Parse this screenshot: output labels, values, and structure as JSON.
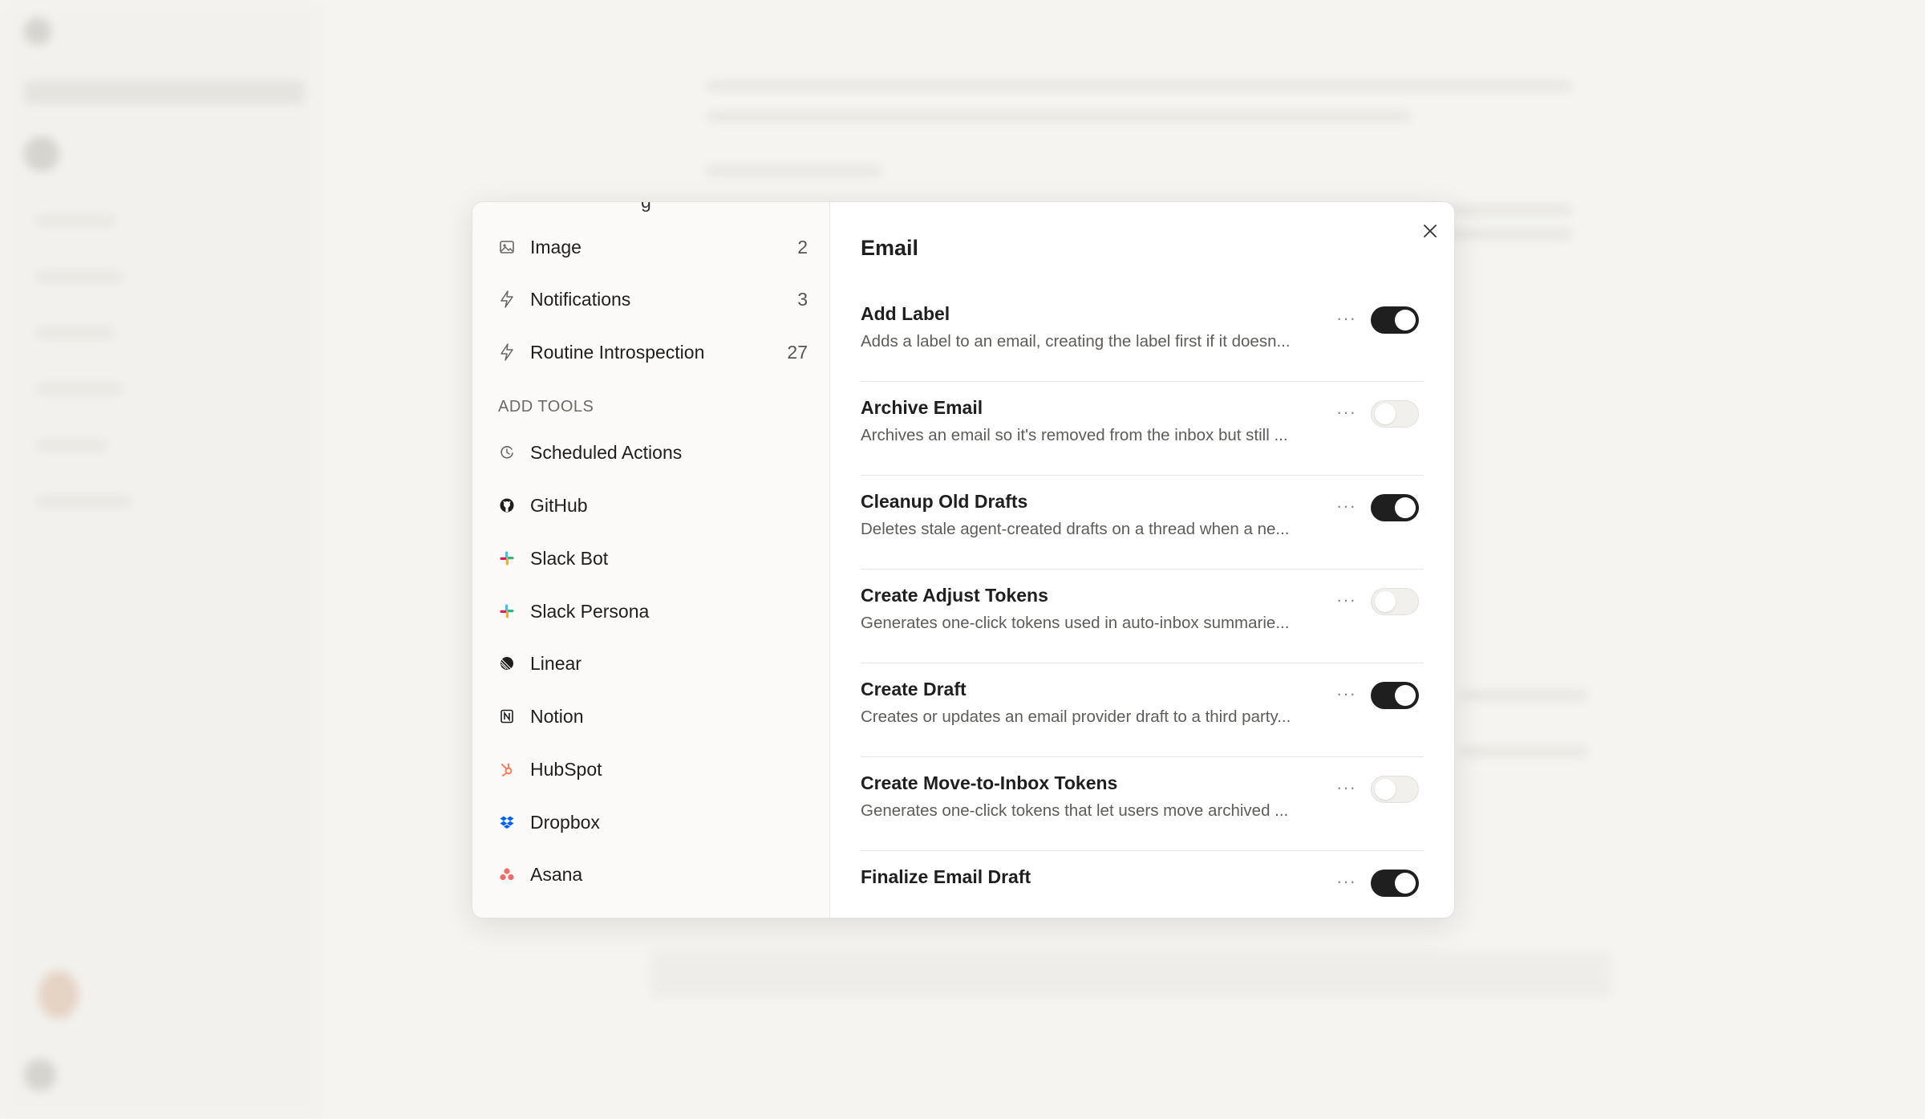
{
  "left_nav": {
    "partial_top_label": "g",
    "items": [
      {
        "label": "Image",
        "count": "2",
        "icon": "image-icon"
      },
      {
        "label": "Notifications",
        "count": "3",
        "icon": "bolt-icon"
      },
      {
        "label": "Routine Introspection",
        "count": "27",
        "icon": "bolt-icon"
      }
    ],
    "add_tools_heading": "ADD TOOLS",
    "add_tools": [
      {
        "label": "Scheduled Actions",
        "icon": "schedule-icon"
      },
      {
        "label": "GitHub",
        "icon": "github-icon"
      },
      {
        "label": "Slack Bot",
        "icon": "slack-icon"
      },
      {
        "label": "Slack Persona",
        "icon": "slack-icon"
      },
      {
        "label": "Linear",
        "icon": "linear-icon"
      },
      {
        "label": "Notion",
        "icon": "notion-icon"
      },
      {
        "label": "HubSpot",
        "icon": "hubspot-icon"
      },
      {
        "label": "Dropbox",
        "icon": "dropbox-icon"
      },
      {
        "label": "Asana",
        "icon": "asana-icon"
      }
    ]
  },
  "panel": {
    "title": "Email",
    "more_label": "···",
    "tools": [
      {
        "name": "Add Label",
        "description": "Adds a label to an email, creating the label first if it doesn...",
        "enabled": true
      },
      {
        "name": "Archive Email",
        "description": "Archives an email so it's removed from the inbox but still ...",
        "enabled": false
      },
      {
        "name": "Cleanup Old Drafts",
        "description": "Deletes stale agent-created drafts on a thread when a ne...",
        "enabled": true
      },
      {
        "name": "Create Adjust Tokens",
        "description": "Generates one-click tokens used in auto-inbox summarie...",
        "enabled": false
      },
      {
        "name": "Create Draft",
        "description": "Creates or updates an email provider draft to a third party...",
        "enabled": true
      },
      {
        "name": "Create Move-to-Inbox Tokens",
        "description": "Generates one-click tokens that let users move archived ...",
        "enabled": false
      },
      {
        "name": "Finalize Email Draft",
        "description": "",
        "enabled": true
      }
    ]
  },
  "colors": {
    "toggle_on": "#1f1f1f",
    "toggle_off": "#f1f0ed",
    "slack": [
      "#36c5f0",
      "#2eb67d",
      "#ecb22e",
      "#e01e5a"
    ],
    "hubspot": "#ff7a59",
    "dropbox": "#0061ff",
    "asana": "#f06a6a"
  }
}
